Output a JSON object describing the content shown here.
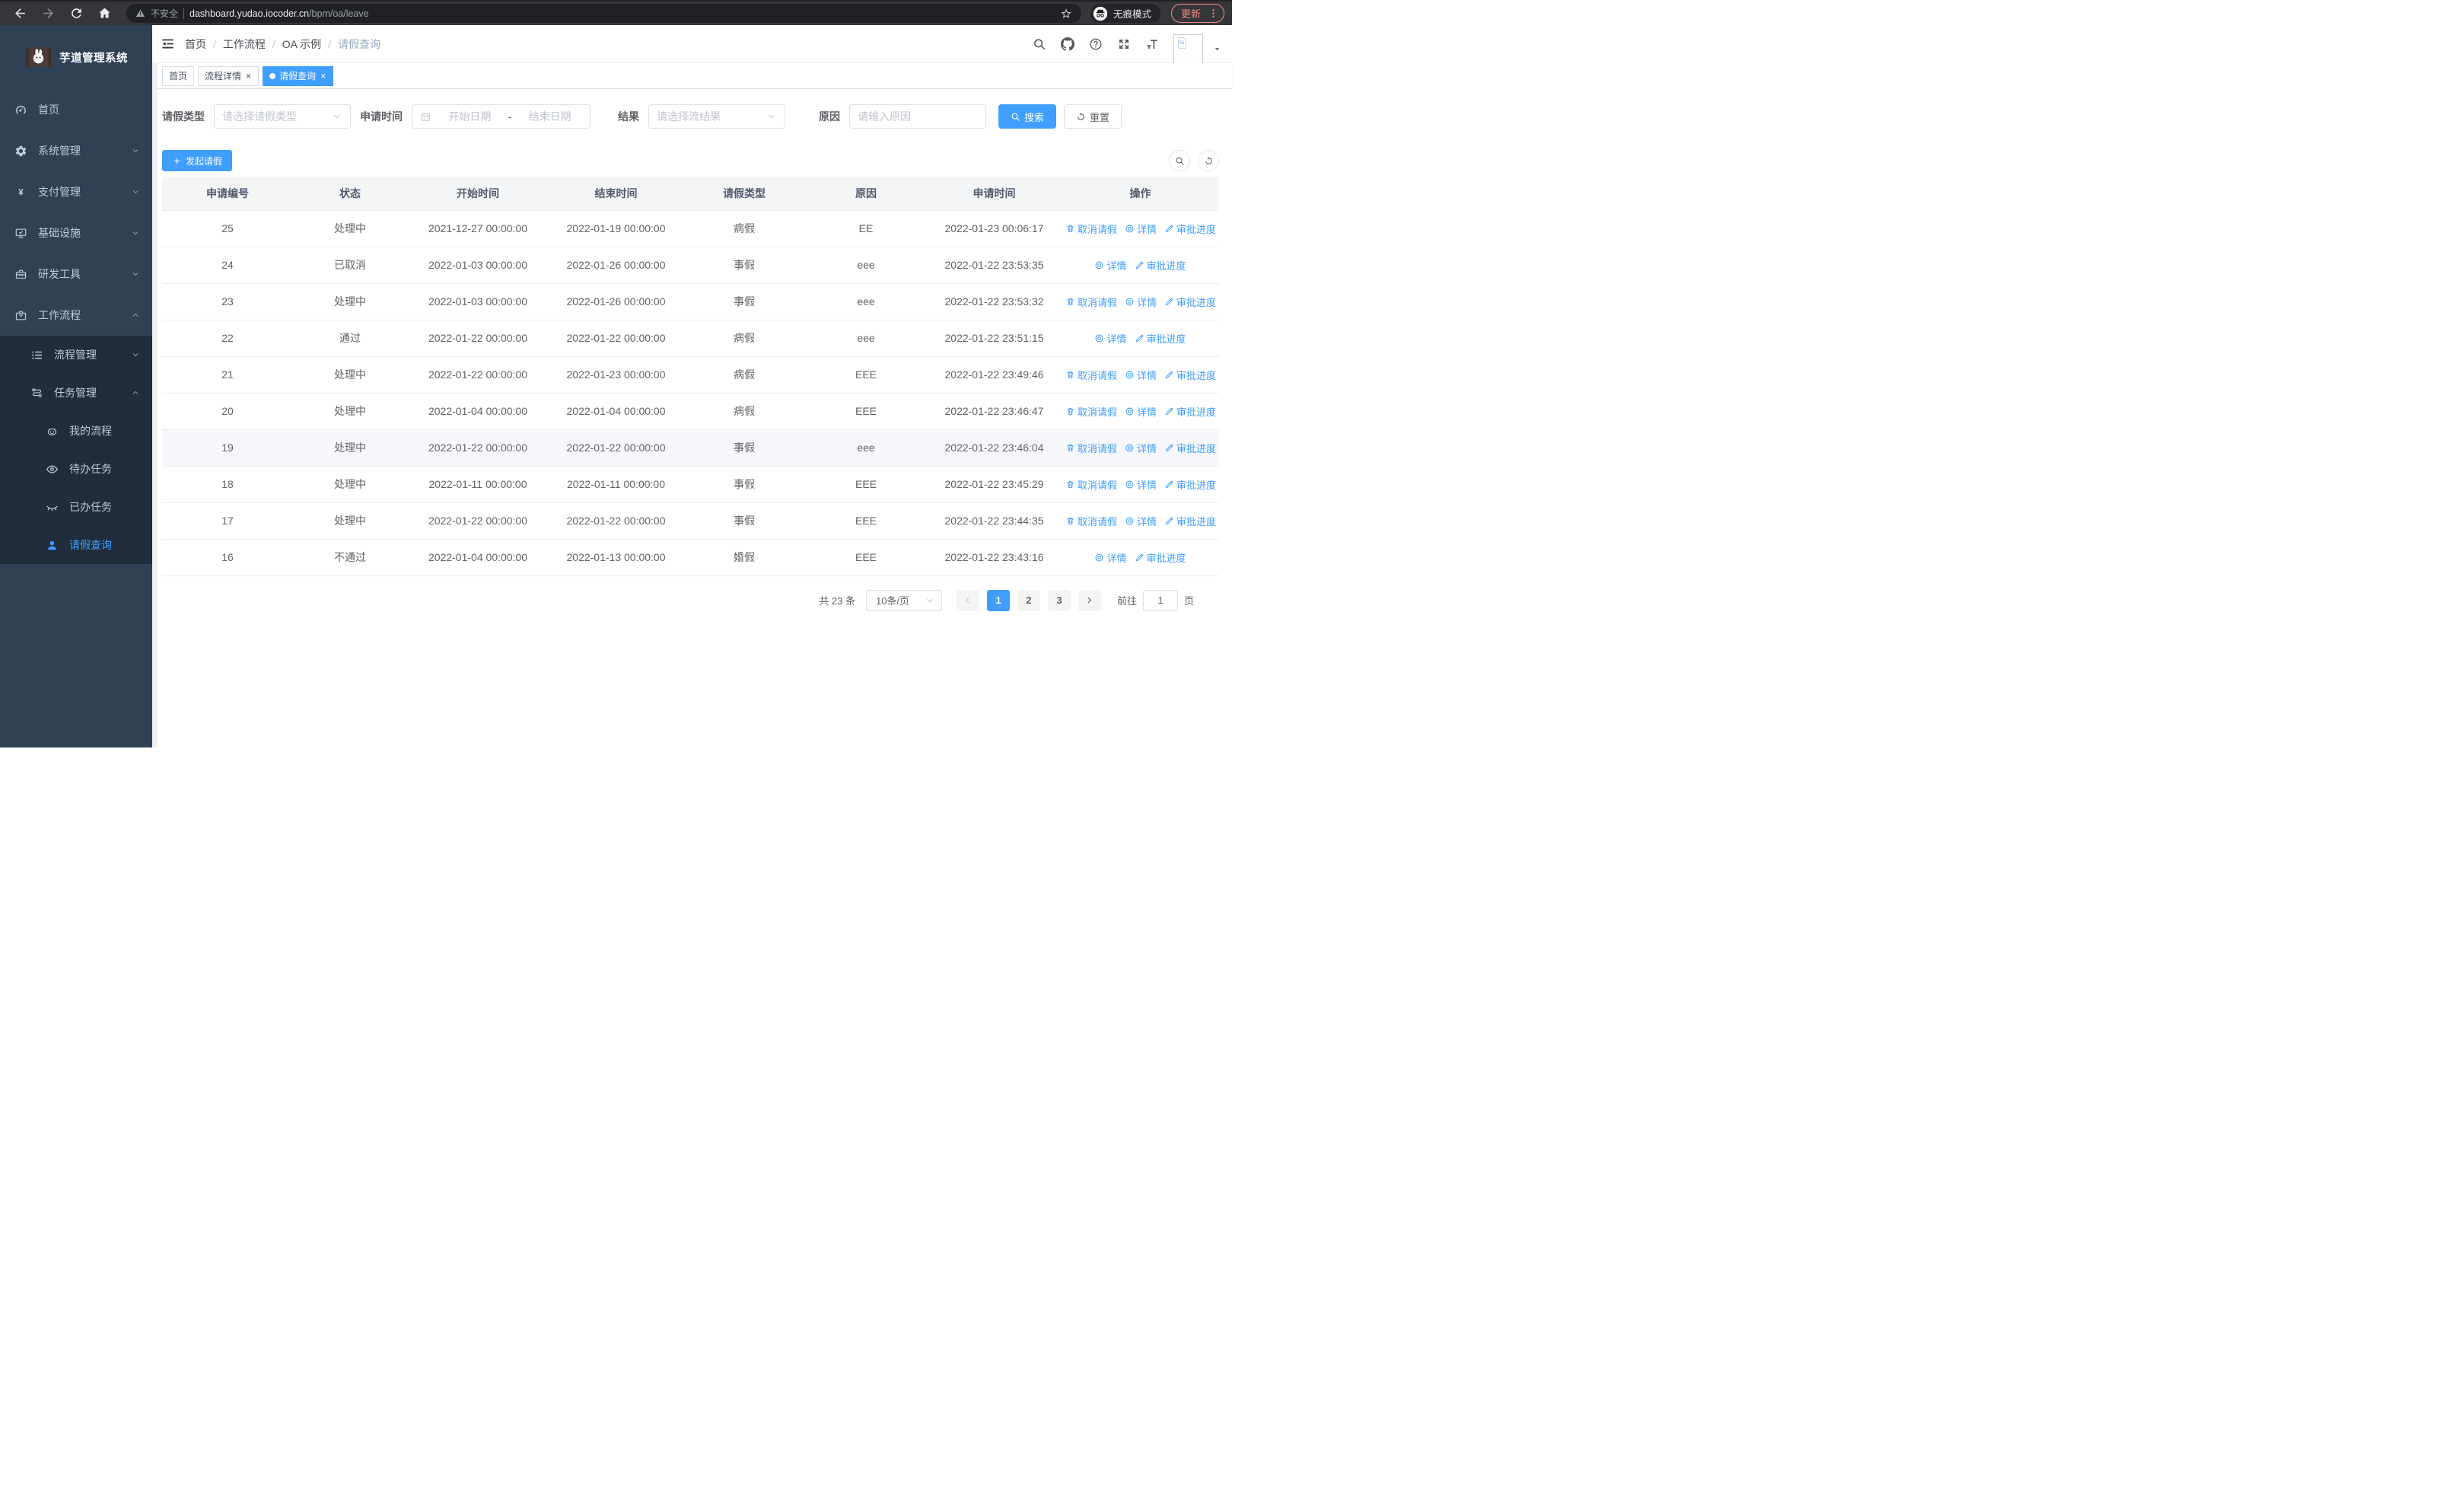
{
  "browser": {
    "security_warning": "不安全",
    "url_domain": "dashboard.yudao.iocoder.cn",
    "url_path": "/bpm/oa/leave",
    "incognito_label": "无痕模式",
    "update_label": "更新"
  },
  "sidebar": {
    "logo_title": "芋道管理系统",
    "items": [
      {
        "key": "home",
        "label": "首页",
        "icon": "dashboard-icon",
        "level": 1
      },
      {
        "key": "system",
        "label": "系统管理",
        "icon": "gear-icon",
        "level": 1,
        "chevron": "down"
      },
      {
        "key": "payment",
        "label": "支付管理",
        "icon": "yen-icon",
        "level": 1,
        "chevron": "down"
      },
      {
        "key": "infrastructure",
        "label": "基础设施",
        "icon": "monitor-icon",
        "level": 1,
        "chevron": "down"
      },
      {
        "key": "dev-tools",
        "label": "研发工具",
        "icon": "toolbox-icon",
        "level": 1,
        "chevron": "down"
      },
      {
        "key": "workflow",
        "label": "工作流程",
        "icon": "briefcase-icon",
        "level": 1,
        "chevron": "up"
      },
      {
        "key": "process-mgmt",
        "label": "流程管理",
        "icon": "stream-icon",
        "level": 2,
        "chevron": "down",
        "submenu": true
      },
      {
        "key": "task-mgmt",
        "label": "任务管理",
        "icon": "flow-icon",
        "level": 2,
        "chevron": "up",
        "submenu": true
      },
      {
        "key": "my-process",
        "label": "我的流程",
        "icon": "robot-icon",
        "level": 3,
        "submenu": true
      },
      {
        "key": "todo-tasks",
        "label": "待办任务",
        "icon": "eye-icon",
        "level": 3,
        "submenu": true
      },
      {
        "key": "done-tasks",
        "label": "已办任务",
        "icon": "eye-closed-icon",
        "level": 3,
        "submenu": true
      },
      {
        "key": "leave-query",
        "label": "请假查询",
        "icon": "user-icon",
        "level": 3,
        "submenu": true,
        "active": true
      }
    ]
  },
  "navbar": {
    "breadcrumb": {
      "items": [
        "首页",
        "工作流程",
        "OA 示例",
        "请假查询"
      ],
      "separator": "/"
    },
    "icons": [
      {
        "key": "search-icon"
      },
      {
        "key": "github-icon"
      },
      {
        "key": "question-icon"
      },
      {
        "key": "fullscreen-icon"
      },
      {
        "key": "fontsize-icon"
      }
    ]
  },
  "tags": {
    "close_glyph": "×",
    "items": [
      {
        "key": "home",
        "label": "首页"
      },
      {
        "key": "process-detail",
        "label": "流程详情",
        "closable": true
      },
      {
        "key": "leave-query",
        "label": "请假查询",
        "closable": true,
        "active": true
      }
    ]
  },
  "filters": {
    "leave_type": {
      "label": "请假类型",
      "placeholder": "请选择请假类型"
    },
    "apply_time": {
      "label": "申请时间",
      "start_placeholder": "开始日期",
      "separator": "-",
      "end_placeholder": "结束日期"
    },
    "result": {
      "label": "结果",
      "placeholder": "请选择流结果"
    },
    "reason": {
      "label": "原因",
      "placeholder": "请输入原因"
    },
    "search_label": "搜索",
    "reset_label": "重置"
  },
  "toolbar": {
    "create_label": "发起请假"
  },
  "table": {
    "columns": [
      {
        "key": "id",
        "label": "申请编号"
      },
      {
        "key": "status",
        "label": "状态"
      },
      {
        "key": "start_time",
        "label": "开始时间"
      },
      {
        "key": "end_time",
        "label": "结束时间"
      },
      {
        "key": "leave_type",
        "label": "请假类型"
      },
      {
        "key": "reason",
        "label": "原因"
      },
      {
        "key": "apply_time",
        "label": "申请时间"
      },
      {
        "key": "actions",
        "label": "操作"
      }
    ],
    "action_defs": {
      "cancel": {
        "label": "取消请假",
        "icon": "delete-icon"
      },
      "detail": {
        "label": "详情",
        "icon": "view-icon"
      },
      "progress": {
        "label": "审批进度",
        "icon": "edit-icon"
      }
    },
    "rows": [
      {
        "id": "25",
        "status": "处理中",
        "start_time": "2021-12-27 00:00:00",
        "end_time": "2022-01-19 00:00:00",
        "leave_type": "病假",
        "reason": "EE",
        "apply_time": "2022-01-23 00:06:17",
        "actions": [
          "cancel",
          "detail",
          "progress"
        ]
      },
      {
        "id": "24",
        "status": "已取消",
        "start_time": "2022-01-03 00:00:00",
        "end_time": "2022-01-26 00:00:00",
        "leave_type": "事假",
        "reason": "eee",
        "apply_time": "2022-01-22 23:53:35",
        "actions": [
          "detail",
          "progress"
        ]
      },
      {
        "id": "23",
        "status": "处理中",
        "start_time": "2022-01-03 00:00:00",
        "end_time": "2022-01-26 00:00:00",
        "leave_type": "事假",
        "reason": "eee",
        "apply_time": "2022-01-22 23:53:32",
        "actions": [
          "cancel",
          "detail",
          "progress"
        ]
      },
      {
        "id": "22",
        "status": "通过",
        "start_time": "2022-01-22 00:00:00",
        "end_time": "2022-01-22 00:00:00",
        "leave_type": "病假",
        "reason": "eee",
        "apply_time": "2022-01-22 23:51:15",
        "actions": [
          "detail",
          "progress"
        ]
      },
      {
        "id": "21",
        "status": "处理中",
        "start_time": "2022-01-22 00:00:00",
        "end_time": "2022-01-23 00:00:00",
        "leave_type": "病假",
        "reason": "EEE",
        "apply_time": "2022-01-22 23:49:46",
        "actions": [
          "cancel",
          "detail",
          "progress"
        ]
      },
      {
        "id": "20",
        "status": "处理中",
        "start_time": "2022-01-04 00:00:00",
        "end_time": "2022-01-04 00:00:00",
        "leave_type": "病假",
        "reason": "EEE",
        "apply_time": "2022-01-22 23:46:47",
        "actions": [
          "cancel",
          "detail",
          "progress"
        ]
      },
      {
        "id": "19",
        "status": "处理中",
        "start_time": "2022-01-22 00:00:00",
        "end_time": "2022-01-22 00:00:00",
        "leave_type": "事假",
        "reason": "eee",
        "apply_time": "2022-01-22 23:46:04",
        "actions": [
          "cancel",
          "detail",
          "progress"
        ],
        "highlighted": true
      },
      {
        "id": "18",
        "status": "处理中",
        "start_time": "2022-01-11 00:00:00",
        "end_time": "2022-01-11 00:00:00",
        "leave_type": "事假",
        "reason": "EEE",
        "apply_time": "2022-01-22 23:45:29",
        "actions": [
          "cancel",
          "detail",
          "progress"
        ]
      },
      {
        "id": "17",
        "status": "处理中",
        "start_time": "2022-01-22 00:00:00",
        "end_time": "2022-01-22 00:00:00",
        "leave_type": "事假",
        "reason": "EEE",
        "apply_time": "2022-01-22 23:44:35",
        "actions": [
          "cancel",
          "detail",
          "progress"
        ]
      },
      {
        "id": "16",
        "status": "不通过",
        "start_time": "2022-01-04 00:00:00",
        "end_time": "2022-01-13 00:00:00",
        "leave_type": "婚假",
        "reason": "EEE",
        "apply_time": "2022-01-22 23:43:16",
        "actions": [
          "detail",
          "progress"
        ]
      }
    ]
  },
  "pagination": {
    "total_text": "共 23 条",
    "page_size": "10条/页",
    "pages": [
      "1",
      "2",
      "3"
    ],
    "active_page": "1",
    "goto_label": "前往",
    "goto_value": "1",
    "goto_suffix": "页"
  },
  "colors": {
    "primary": "#409eff",
    "sidebar-bg": "#304156",
    "submenu-bg": "#1f2d3d",
    "sidebar-text": "#bfcbd9",
    "browser-bar": "#35363a",
    "browser-pill": "#202124",
    "update-accent": "#f28b82",
    "input-border": "#dcdfe6",
    "table-border": "#ebeef5",
    "table-header-bg": "#f4f5f7",
    "text": "#606266",
    "breadcrumb-muted": "#97a8be",
    "placeholder": "#c0c4cc",
    "row-highlight": "#f5f7fa"
  }
}
